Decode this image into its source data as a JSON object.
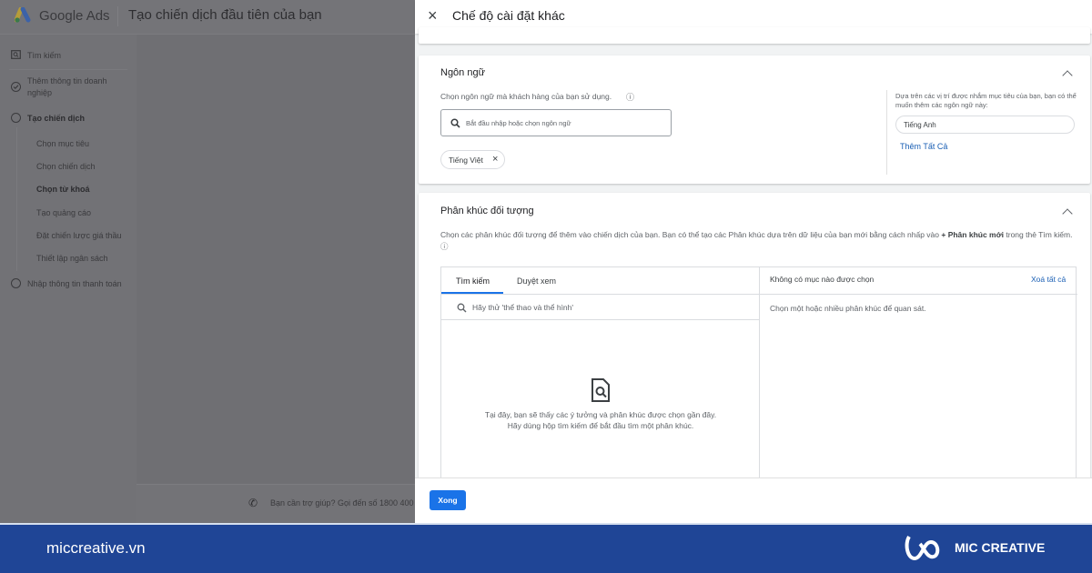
{
  "app": {
    "brand": "Google Ads",
    "page_title": "Tạo chiến dịch đầu tiên của bạn"
  },
  "sidebar": {
    "items": [
      {
        "label": "Tìm kiếm",
        "icon": "search-box-icon"
      },
      {
        "label": "Thêm thông tin doanh nghiệp",
        "icon": "check-circle-icon"
      },
      {
        "label": "Tạo chiến dịch",
        "icon": "circle-icon",
        "bold": true
      },
      {
        "label": "Chọn mục tiêu"
      },
      {
        "label": "Chọn chiến dịch"
      },
      {
        "label": "Chọn từ khoá",
        "bold": true
      },
      {
        "label": "Tạo quảng cáo"
      },
      {
        "label": "Đặt chiến lược giá thầu"
      },
      {
        "label": "Thiết lập ngân sách"
      },
      {
        "label": "Nhập thông tin thanh toán",
        "icon": "circle-icon"
      }
    ]
  },
  "help": {
    "text": "Bạn cần trợ giúp? Gọi đến số 1800 400"
  },
  "panel": {
    "title": "Chế độ cài đặt khác",
    "language": {
      "title": "Ngôn ngữ",
      "prompt": "Chọn ngôn ngữ mà khách hàng của bạn sử dụng.",
      "search_placeholder": "Bắt đầu nhập hoặc chọn ngôn ngữ",
      "selected_chip": "Tiếng Việt",
      "suggest_text": "Dựa trên các vị trí được nhắm mục tiêu của bạn, bạn có thể muốn thêm các ngôn ngữ này:",
      "suggestion": "Tiếng Anh",
      "add_all": "Thêm Tất Cả"
    },
    "audience": {
      "title": "Phân khúc đối tượng",
      "desc_1": "Chọn các phân khúc đối tượng để thêm vào chiến dịch của bạn. Bạn có thể tạo các Phân khúc dựa trên dữ liệu của bạn mới bằng cách nhấp vào ",
      "desc_bold": "+ Phân khúc mới",
      "desc_2": " trong thẻ Tìm kiếm.",
      "tabs": [
        "Tìm kiếm",
        "Duyệt xem"
      ],
      "search_placeholder": "Hãy thử 'thể thao và thể hình'",
      "empty_1": "Tại đây, bạn sẽ thấy các ý tưởng và phân khúc được chọn gần đây.",
      "empty_2": "Hãy dùng hộp tìm kiếm để bắt đầu tìm một phân khúc.",
      "selected_header": "Không có mục nào được chọn",
      "clear_all": "Xoá tất cả",
      "selected_empty": "Chọn một hoặc nhiều phân khúc để quan sát."
    },
    "done": "Xong"
  },
  "footer": {
    "site": "miccreative.vn",
    "logo_text": "MIC CREATIVE"
  },
  "colors": {
    "accent": "#1a73e8",
    "footer": "#1f4596"
  }
}
